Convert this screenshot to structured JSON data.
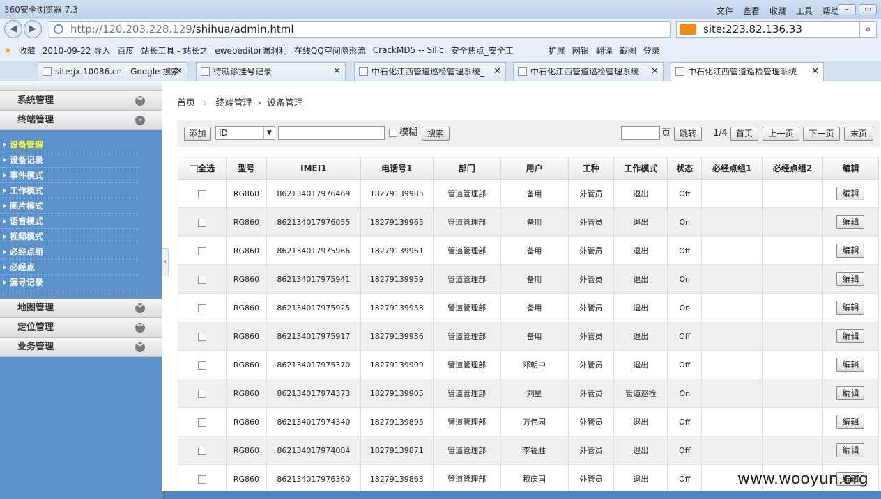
{
  "browser": {
    "title": "360安全浏览器 7.3",
    "menu": [
      "文件",
      "查看",
      "收藏",
      "工具",
      "帮助"
    ],
    "url_host": "http://120.203.228.129",
    "url_path": "/shihua/admin.html",
    "search_text": "site:223.82.136.33",
    "bookmarks": [
      "收藏",
      "2010-09-22 导入",
      "百度",
      "站长工具 - 站长之",
      "ewebeditor漏洞利",
      "在线QQ空间隐形流",
      "CrackMD5 -- Silic",
      "安全焦点_安全工",
      "扩展",
      "网银",
      "翻译",
      "截图",
      "登录"
    ],
    "tabs": [
      {
        "label": "site:jx.10086.cn - Google 搜索"
      },
      {
        "label": "待就诊挂号记录"
      },
      {
        "label": "中石化江西管道巡检管理系统_"
      },
      {
        "label": "中石化江西管道巡检管理系统"
      },
      {
        "label": "中石化江西管道巡检管理系统"
      }
    ]
  },
  "sidebar": {
    "top_sections": [
      "系统管理",
      "终端管理"
    ],
    "items": [
      "设备管理",
      "设备记录",
      "事件模式",
      "工作模式",
      "图片模式",
      "语音模式",
      "视频模式",
      "必经点组",
      "必经点",
      "漏寻记录"
    ],
    "bottom_sections": [
      "地图管理",
      "定位管理",
      "业务管理"
    ]
  },
  "breadcrumb": {
    "home": "首页",
    "level1": "终端管理",
    "level2": "设备管理"
  },
  "toolbar": {
    "add_label": "添加",
    "field_select": "ID",
    "fuzzy_label": "模糊",
    "search_label": "搜索",
    "page_suffix": "页",
    "jump_label": "跳转",
    "page_info": "1/4",
    "first_label": "首页",
    "prev_label": "上一页",
    "next_label": "下一页",
    "last_label": "末页"
  },
  "table": {
    "select_all": "全选",
    "headers": [
      "型号",
      "IMEI1",
      "电话号1",
      "部门",
      "用户",
      "工种",
      "工作模式",
      "状态",
      "必经点组1",
      "必经点组2",
      "编辑"
    ],
    "edit_label": "编辑",
    "rows": [
      [
        "RG860",
        "862134017976469",
        "18279139985",
        "管道管理部",
        "备用",
        "外管员",
        "退出",
        "Off",
        "",
        ""
      ],
      [
        "RG860",
        "862134017976055",
        "18279139965",
        "管道管理部",
        "备用",
        "外管员",
        "退出",
        "On",
        "",
        ""
      ],
      [
        "RG860",
        "862134017975966",
        "18279139961",
        "管道管理部",
        "备用",
        "外管员",
        "退出",
        "Off",
        "",
        ""
      ],
      [
        "RG860",
        "862134017975941",
        "18279139959",
        "管道管理部",
        "备用",
        "外管员",
        "退出",
        "On",
        "",
        ""
      ],
      [
        "RG860",
        "862134017975925",
        "18279139953",
        "管道管理部",
        "备用",
        "外管员",
        "退出",
        "On",
        "",
        ""
      ],
      [
        "RG860",
        "862134017975917",
        "18279139936",
        "管道管理部",
        "备用",
        "外管员",
        "退出",
        "Off",
        "",
        ""
      ],
      [
        "RG860",
        "862134017975370",
        "18279139909",
        "管道管理部",
        "邓朝中",
        "外管员",
        "退出",
        "Off",
        "",
        ""
      ],
      [
        "RG860",
        "862134017974373",
        "18279139905",
        "管道管理部",
        "刘星",
        "外管员",
        "管道巡检",
        "On",
        "",
        ""
      ],
      [
        "RG860",
        "862134017974340",
        "18279139895",
        "管道管理部",
        "万伟园",
        "外管员",
        "退出",
        "Off",
        "",
        ""
      ],
      [
        "RG860",
        "862134017974084",
        "18279139871",
        "管道管理部",
        "李福胜",
        "外管员",
        "退出",
        "Off",
        "",
        ""
      ],
      [
        "RG860",
        "862134017976360",
        "18279139863",
        "管道管理部",
        "穆庆国",
        "外管员",
        "退出",
        "Off",
        "",
        ""
      ]
    ]
  },
  "watermark": "www.wooyun.org"
}
